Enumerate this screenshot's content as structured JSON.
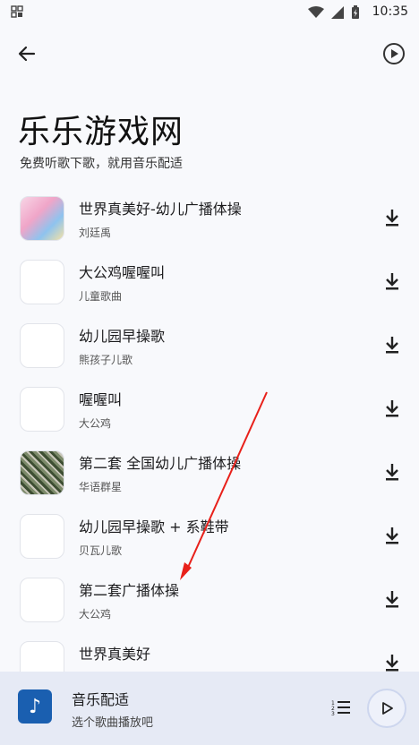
{
  "status": {
    "time": "10:35"
  },
  "header": {
    "title": "乐乐游戏网",
    "subtitle": "免费听歌下歌，就用音乐配适"
  },
  "songs": [
    {
      "title": "世界真美好-幼儿广播体操",
      "artist": "刘廷禹"
    },
    {
      "title": "大公鸡喔喔叫",
      "artist": "儿童歌曲"
    },
    {
      "title": "幼儿园早操歌",
      "artist": "熊孩子儿歌"
    },
    {
      "title": "喔喔叫",
      "artist": "大公鸡"
    },
    {
      "title": "第二套 全国幼儿广播体操",
      "artist": "华语群星"
    },
    {
      "title": "幼儿园早操歌 + 系鞋带",
      "artist": "贝瓦儿歌"
    },
    {
      "title": "第二套广播体操",
      "artist": "大公鸡"
    },
    {
      "title": "世界真美好",
      "artist": ""
    }
  ],
  "player": {
    "title": "音乐配适",
    "subtitle": "选个歌曲播放吧"
  }
}
